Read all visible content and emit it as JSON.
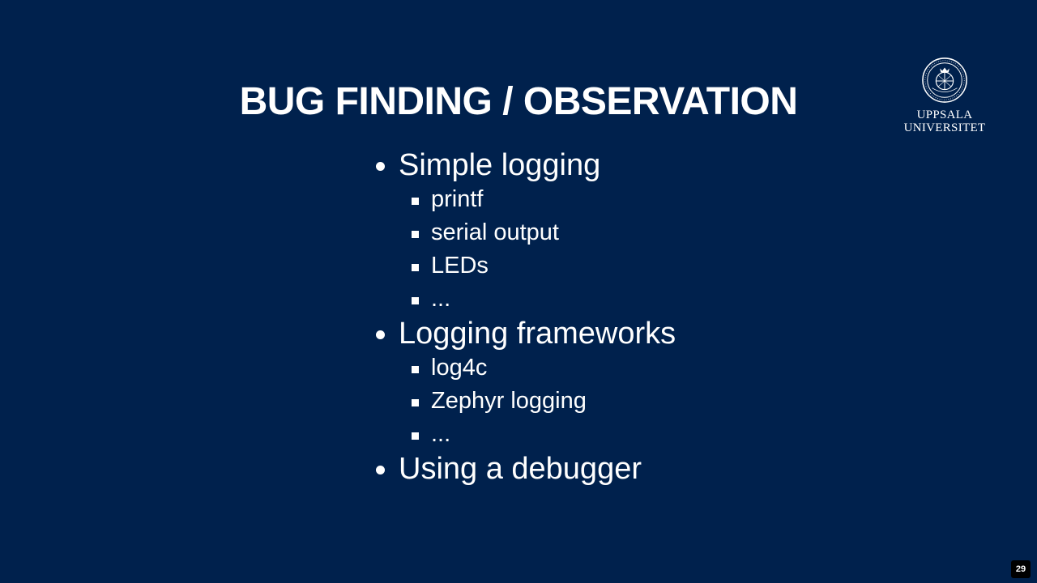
{
  "slide": {
    "title": "BUG FINDING / OBSERVATION",
    "logo": {
      "line1": "UPPSALA",
      "line2": "UNIVERSITET"
    },
    "bullets": [
      {
        "label": "Simple logging",
        "subitems": [
          "printf",
          "serial output",
          "LEDs",
          "..."
        ]
      },
      {
        "label": "Logging frameworks",
        "subitems": [
          "log4c",
          "Zephyr logging",
          "..."
        ]
      },
      {
        "label": "Using a debugger",
        "subitems": []
      }
    ],
    "page_number": "29",
    "colors": {
      "background": "#00214d",
      "text": "#ffffff"
    }
  }
}
